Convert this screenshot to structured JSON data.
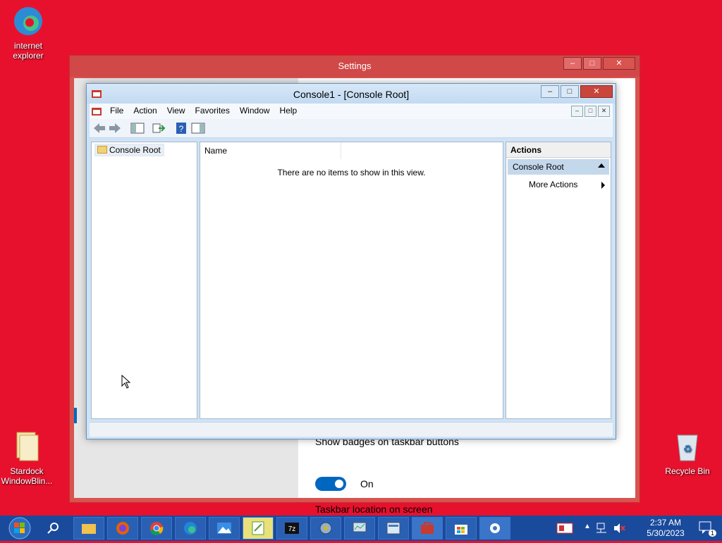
{
  "desktop": {
    "icons": [
      {
        "label": "internet explorer"
      },
      {
        "label": "Stardock WindowBlin..."
      },
      {
        "label": "Recycle Bin"
      }
    ]
  },
  "settings": {
    "title": "Settings",
    "badges_label": "Show badges on taskbar buttons",
    "toggle_state": "On",
    "location_label": "Taskbar location on screen"
  },
  "mmc": {
    "title": "Console1 - [Console Root]",
    "menus": [
      "File",
      "Action",
      "View",
      "Favorites",
      "Window",
      "Help"
    ],
    "tree_root": "Console Root",
    "column_name": "Name",
    "empty_message": "There are no items to show in this view.",
    "actions_header": "Actions",
    "actions_section": "Console Root",
    "more_actions": "More Actions"
  },
  "caption": {
    "minimize": "–",
    "maximize": "□",
    "close": "✕"
  },
  "taskbar": {
    "time": "2:37 AM",
    "date": "5/30/2023",
    "notification_count": "1"
  }
}
